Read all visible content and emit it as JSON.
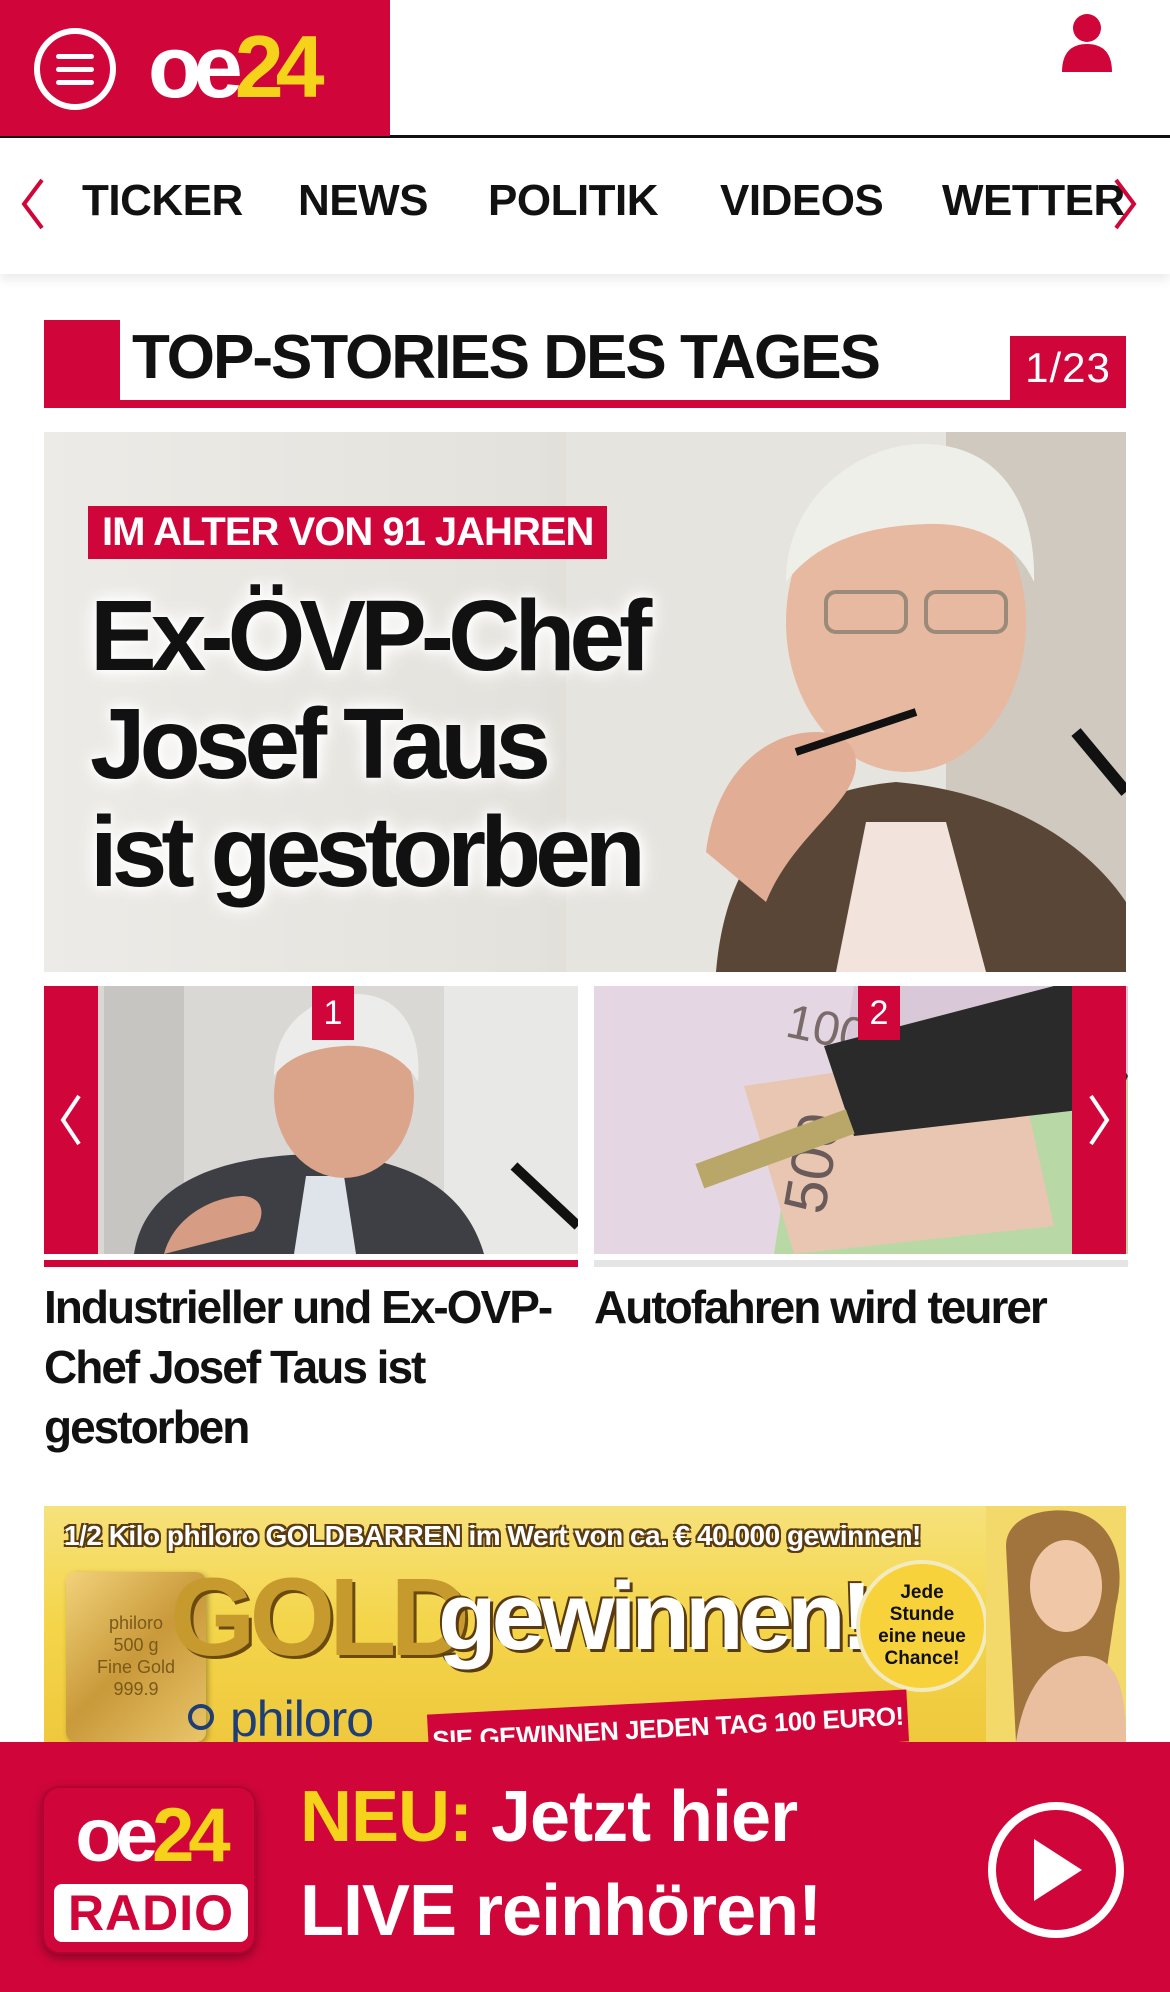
{
  "header": {
    "logo_oe": "oe",
    "logo_num": "24",
    "menu_icon": "hamburger-menu-icon",
    "user_icon": "user-icon"
  },
  "nav": {
    "items": [
      {
        "label": "TICKER"
      },
      {
        "label": "NEWS"
      },
      {
        "label": "POLITIK"
      },
      {
        "label": "VIDEOS"
      },
      {
        "label": "WETTER"
      }
    ],
    "prev_icon": "chevron-left-icon",
    "next_icon": "chevron-right-icon"
  },
  "section": {
    "title": "TOP-STORIES DES TAGES",
    "counter": "1/23"
  },
  "hero": {
    "kicker": "IM ALTER VON 91 JAHREN",
    "headline": "Ex-ÖVP-Chef\nJosef Taus\nist gestorben"
  },
  "carousel": {
    "prev_icon": "chevron-left-icon",
    "next_icon": "chevron-right-icon",
    "cards": [
      {
        "rank": "1",
        "title": "Industrieller und Ex-OVP-Chef Josef Taus ist gestorben",
        "image": "portrait-photo"
      },
      {
        "rank": "2",
        "title": "Autofahren wird teurer",
        "image": "car-key-banknotes-photo"
      }
    ]
  },
  "ad": {
    "top_line": "1/2 Kilo philoro GOLDBARREN im Wert von ca. € 40.000 gewinnen!",
    "gold_word": "GOLD",
    "gewinnen": "gewinnen!",
    "badge": "Jede\nStunde\neine neue\nChance!",
    "brand": "philoro",
    "ribbon": "SIE GEWINNEN JEDEN TAG 100 EURO!",
    "gold_bar_text": "philoro\n500 g\nFine Gold\n999.9"
  },
  "radio": {
    "logo_oe": "oe",
    "logo_num": "24",
    "logo_radio": "RADIO",
    "neu": "NEU:",
    "line1_rest": " Jetzt hier",
    "line2": "LIVE reinhören!",
    "play_icon": "play-icon"
  },
  "colors": {
    "brand_red": "#d0063a",
    "brand_yellow": "#f5d31b"
  }
}
